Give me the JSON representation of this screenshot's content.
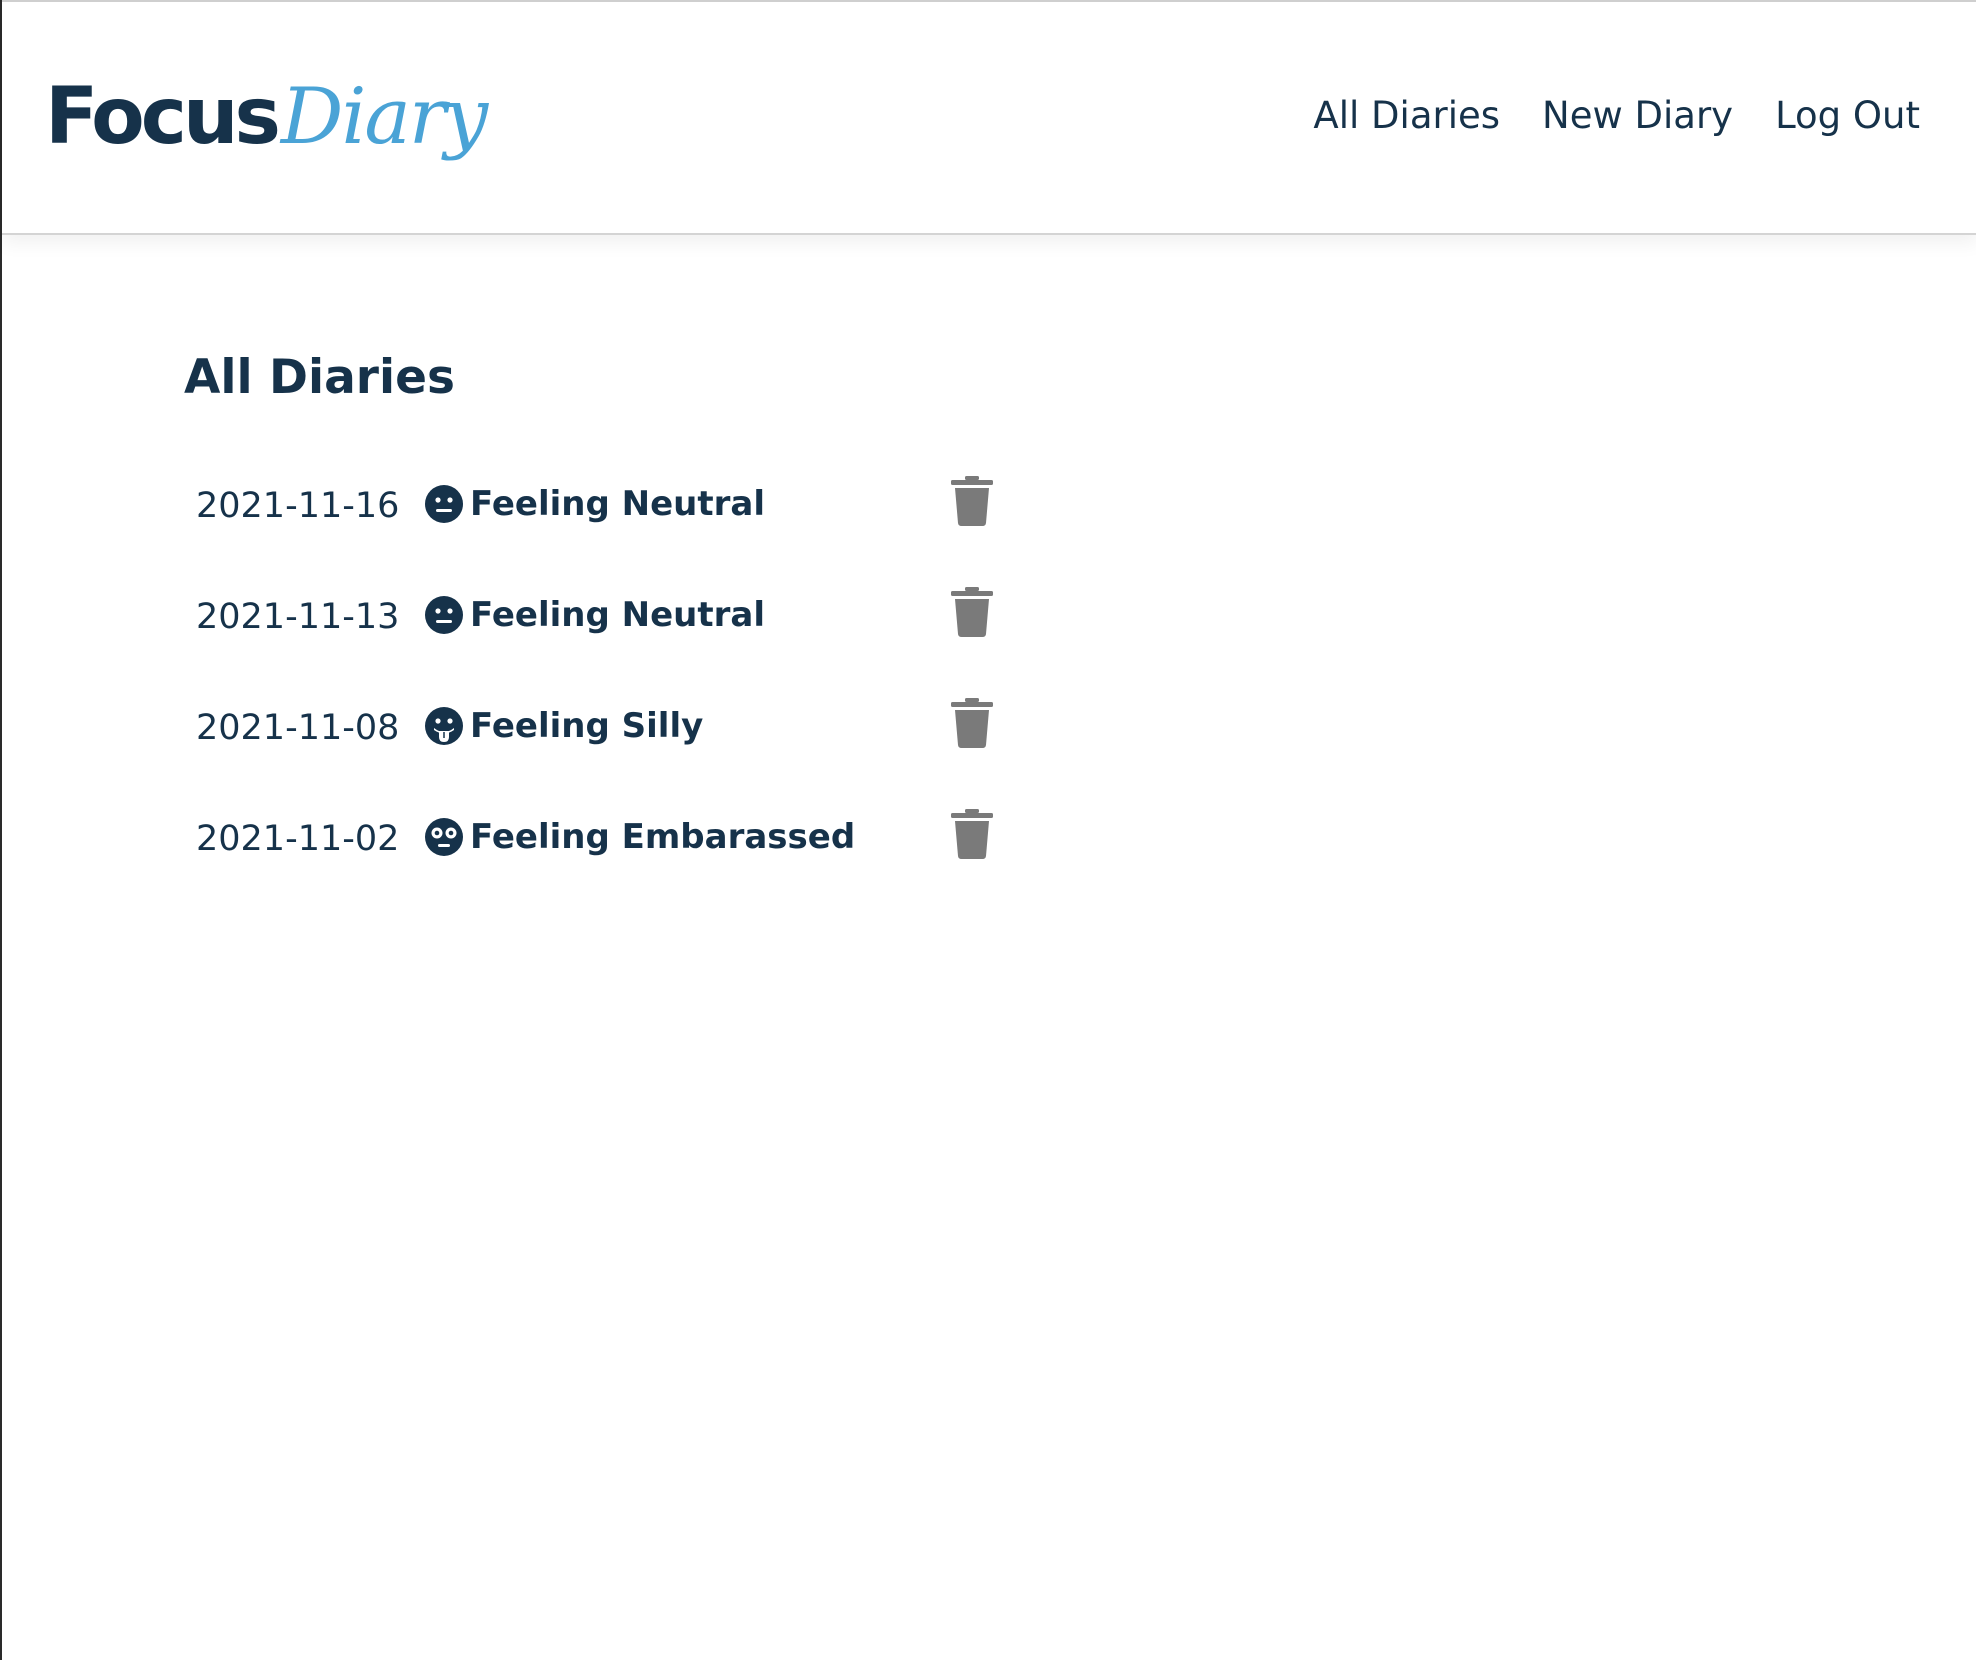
{
  "brand": {
    "logo_primary": "Focus",
    "logo_secondary": "Diary",
    "colors": {
      "primary": "#16324a",
      "accent": "#4aa3d6",
      "trash": "#7a7a7a"
    }
  },
  "nav": {
    "items": [
      {
        "label": "All Diaries"
      },
      {
        "label": "New Diary"
      },
      {
        "label": "Log Out"
      }
    ]
  },
  "main": {
    "title": "All Diaries",
    "entries": [
      {
        "date": "2021-11-16",
        "mood": "Feeling Neutral",
        "mood_icon": "neutral-face-icon",
        "action_icon": "trash-icon"
      },
      {
        "date": "2021-11-13",
        "mood": "Feeling Neutral",
        "mood_icon": "neutral-face-icon",
        "action_icon": "trash-icon"
      },
      {
        "date": "2021-11-08",
        "mood": "Feeling Silly",
        "mood_icon": "tongue-face-icon",
        "action_icon": "trash-icon"
      },
      {
        "date": "2021-11-02",
        "mood": "Feeling Embarassed",
        "mood_icon": "flushed-face-icon",
        "action_icon": "trash-icon"
      }
    ]
  }
}
